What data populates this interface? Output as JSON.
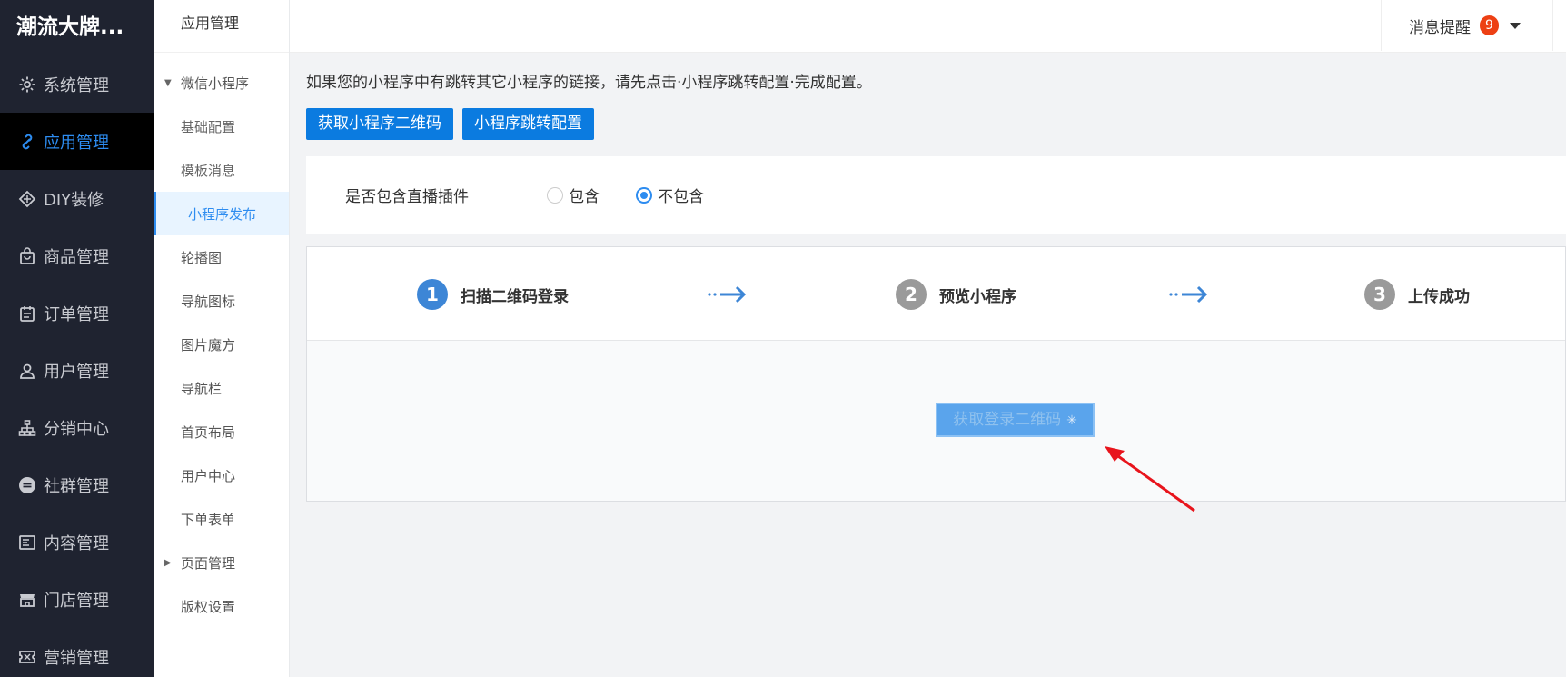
{
  "sidebar": {
    "brand": "潮流大牌...",
    "items": [
      {
        "label": "系统管理",
        "icon": "gear-icon"
      },
      {
        "label": "应用管理",
        "icon": "link-icon"
      },
      {
        "label": "DIY装修",
        "icon": "diamond-icon"
      },
      {
        "label": "商品管理",
        "icon": "bag-icon"
      },
      {
        "label": "订单管理",
        "icon": "calendar-icon"
      },
      {
        "label": "用户管理",
        "icon": "user-icon"
      },
      {
        "label": "分销中心",
        "icon": "sitemap-icon"
      },
      {
        "label": "社群管理",
        "icon": "minus-circle-icon"
      },
      {
        "label": "内容管理",
        "icon": "document-icon"
      },
      {
        "label": "门店管理",
        "icon": "store-icon"
      },
      {
        "label": "营销管理",
        "icon": "ticket-icon"
      }
    ],
    "active_index": 1
  },
  "subnav": {
    "title": "应用管理",
    "items": [
      {
        "label": "微信小程序",
        "type": "group-open"
      },
      {
        "label": "基础配置",
        "type": "child"
      },
      {
        "label": "模板消息",
        "type": "child"
      },
      {
        "label": "小程序发布",
        "type": "child-active"
      },
      {
        "label": "轮播图",
        "type": "item"
      },
      {
        "label": "导航图标",
        "type": "item"
      },
      {
        "label": "图片魔方",
        "type": "item"
      },
      {
        "label": "导航栏",
        "type": "item"
      },
      {
        "label": "首页布局",
        "type": "item"
      },
      {
        "label": "用户中心",
        "type": "item"
      },
      {
        "label": "下单表单",
        "type": "item"
      },
      {
        "label": "页面管理",
        "type": "group-closed"
      },
      {
        "label": "版权设置",
        "type": "item"
      }
    ]
  },
  "topbar": {
    "message_label": "消息提醒",
    "badge_count": "9"
  },
  "main": {
    "notice": "如果您的小程序中有跳转其它小程序的链接，请先点击·小程序跳转配置·完成配置。",
    "btn_get_qrcode": "获取小程序二维码",
    "btn_jump_config": "小程序跳转配置",
    "live_plugin_label": "是否包含直播插件",
    "radio_include": "包含",
    "radio_exclude": "不包含",
    "radio_selected": "不包含",
    "steps": [
      {
        "num": "1",
        "label": "扫描二维码登录"
      },
      {
        "num": "2",
        "label": "预览小程序"
      },
      {
        "num": "3",
        "label": "上传成功"
      }
    ],
    "login_qr_button": "获取登录二维码"
  },
  "colors": {
    "accent": "#0b7be0",
    "sidebar_bg": "#1f2330",
    "active_text": "#2d8cf0",
    "badge": "#ed4014",
    "annotation_arrow": "#e8141c"
  }
}
